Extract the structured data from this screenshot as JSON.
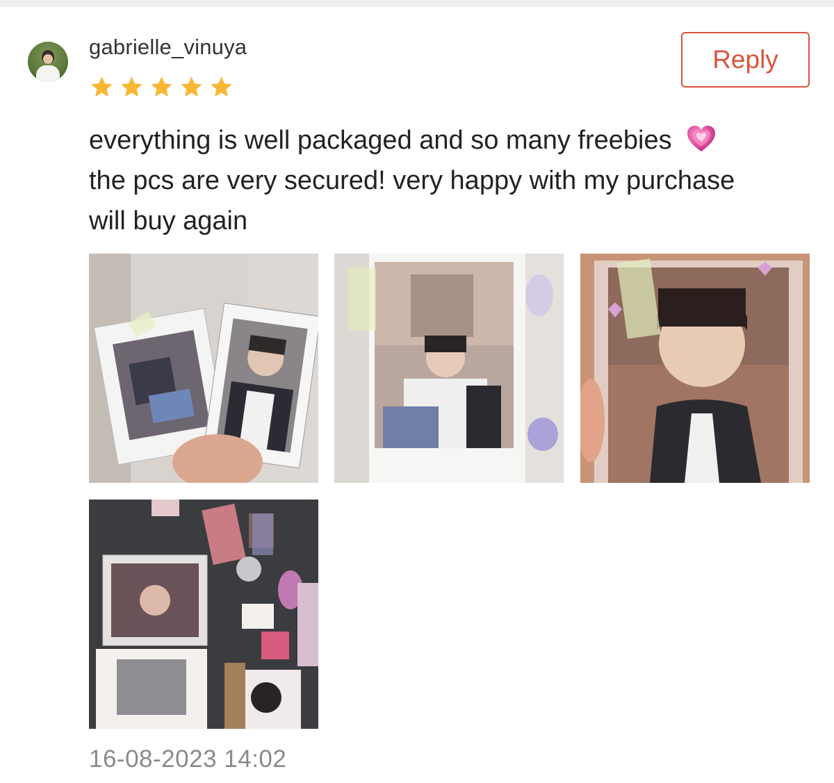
{
  "review": {
    "username": "gabrielle_vinuya",
    "rating": 5,
    "rating_max": 5,
    "reply_label": "Reply",
    "text_lines": [
      "everything is well packaged and so many freebies",
      "the pcs are very secured! very happy with my purchase",
      "will buy again"
    ],
    "emoji": "sparkling-heart-icon",
    "timestamp": "16-08-2023 14:02",
    "photos": [
      {
        "name": "review-photo-1"
      },
      {
        "name": "review-photo-2"
      },
      {
        "name": "review-photo-3"
      },
      {
        "name": "review-photo-4"
      }
    ]
  },
  "colors": {
    "accent": "#d9543a",
    "star": "#f7b733",
    "timestamp": "#8a8a8a",
    "heart": "#e04fa0"
  }
}
